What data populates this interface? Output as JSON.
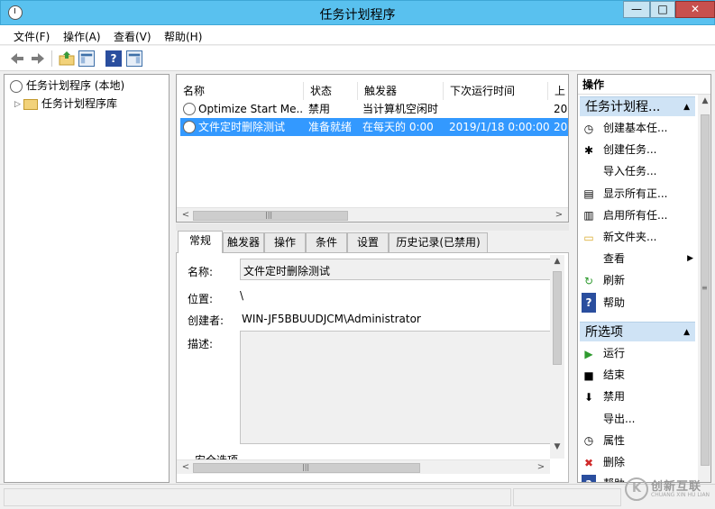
{
  "window": {
    "title": "任务计划程序",
    "min_glyph": "—",
    "max_glyph": "□",
    "close_glyph": "✕"
  },
  "menu": {
    "file": "文件(F)",
    "action": "操作(A)",
    "view": "查看(V)",
    "help": "帮助(H)"
  },
  "tree": {
    "root": "任务计划程序 (本地)",
    "library": "任务计划程序库"
  },
  "task_list": {
    "columns": [
      "名称",
      "状态",
      "触发器",
      "下次运行时间",
      "上"
    ],
    "rows": [
      {
        "name": "Optimize Start Me...",
        "status": "禁用",
        "trigger": "当计算机空闲时",
        "next_run": "",
        "last": "20"
      },
      {
        "name": "文件定时删除测试",
        "status": "准备就绪",
        "trigger": "在每天的 0:00",
        "next_run": "2019/1/18 0:00:00",
        "last": "20",
        "selected": true
      }
    ],
    "scroll_left": "<",
    "scroll_right": ">",
    "scroll_grip": "|||"
  },
  "tabs": [
    "常规",
    "触发器",
    "操作",
    "条件",
    "设置",
    "历史记录(已禁用)"
  ],
  "details": {
    "name_label": "名称:",
    "name_value": "文件定时删除测试",
    "location_label": "位置:",
    "location_value": "\\",
    "author_label": "创建者:",
    "author_value": "WIN-JF5BBUUDJCM\\Administrator",
    "desc_label": "描述:",
    "security_label": "安全选项"
  },
  "actions": {
    "header": "操作",
    "section_library": "任务计划程...",
    "library_items": [
      {
        "icon": "create-basic-task-icon",
        "glyph": "◷",
        "label": "创建基本任..."
      },
      {
        "icon": "create-task-icon",
        "glyph": "✱",
        "label": "创建任务..."
      },
      {
        "icon": "",
        "glyph": "",
        "label": "导入任务..."
      },
      {
        "icon": "show-running-icon",
        "glyph": "▤",
        "label": "显示所有正..."
      },
      {
        "icon": "enable-history-icon",
        "glyph": "▥",
        "label": "启用所有任..."
      },
      {
        "icon": "new-folder-icon",
        "glyph": "▭",
        "label": "新文件夹..."
      },
      {
        "icon": "",
        "glyph": "",
        "label": "查看",
        "submenu": true
      },
      {
        "icon": "refresh-icon",
        "glyph": "↻",
        "label": "刷新"
      },
      {
        "icon": "help-icon",
        "glyph": "?",
        "label": "帮助"
      }
    ],
    "section_selected": "所选项",
    "selected_items": [
      {
        "icon": "run-icon",
        "glyph": "▶",
        "label": "运行"
      },
      {
        "icon": "end-icon",
        "glyph": "■",
        "label": "结束"
      },
      {
        "icon": "disable-icon",
        "glyph": "⬇",
        "label": "禁用"
      },
      {
        "icon": "",
        "glyph": "",
        "label": "导出..."
      },
      {
        "icon": "properties-icon",
        "glyph": "◷",
        "label": "属性"
      },
      {
        "icon": "delete-icon",
        "glyph": "✖",
        "label": "删除"
      },
      {
        "icon": "help-icon",
        "glyph": "?",
        "label": "帮助"
      }
    ]
  },
  "watermark": {
    "mark": "K",
    "name": "创新互联",
    "sub": "CHUANG XIN HU LIAN"
  },
  "colors": {
    "titlebar": "#59c1ef",
    "selection": "#3399ff",
    "section_header": "#cfe3f5",
    "close_button": "#c7504e"
  }
}
